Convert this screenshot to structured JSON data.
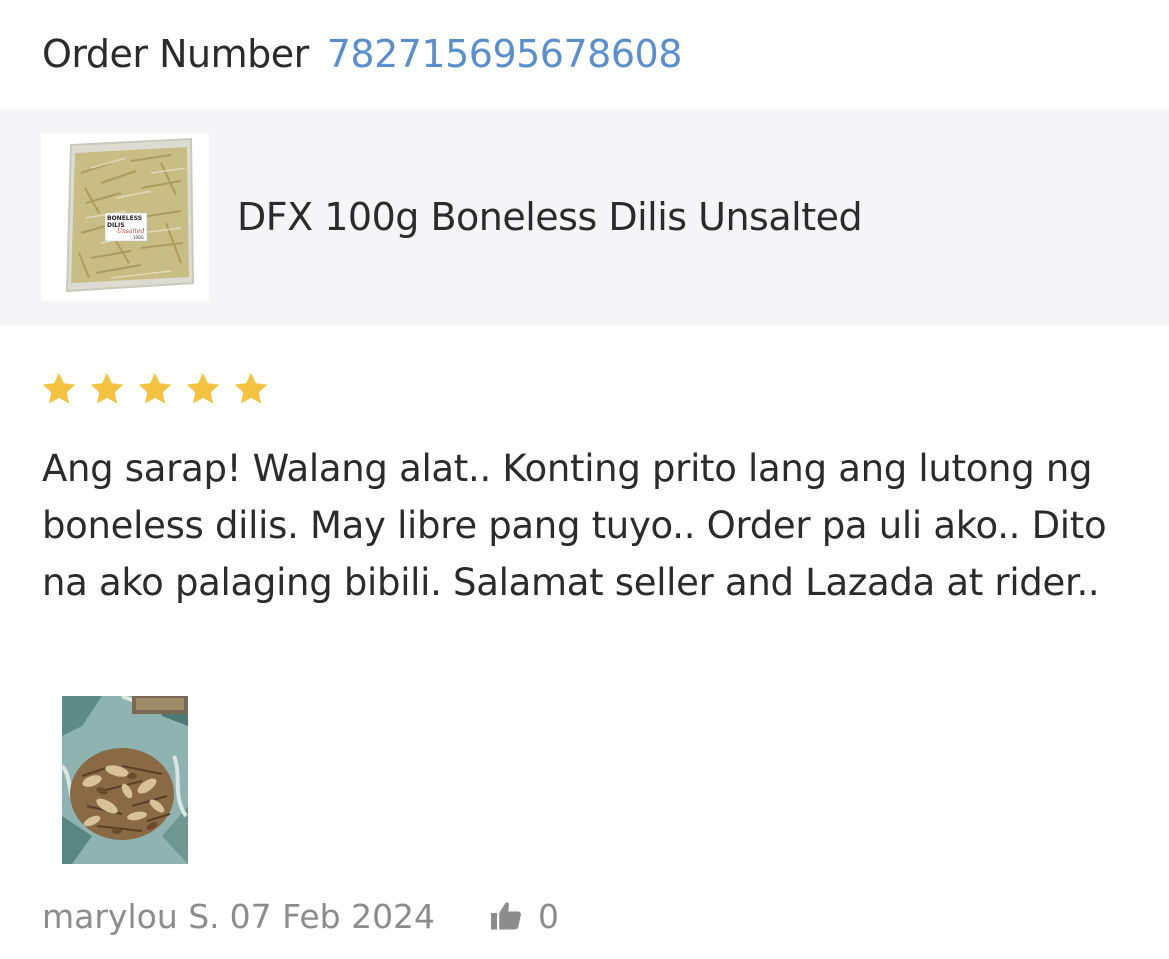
{
  "order": {
    "label": "Order Number",
    "number": "782715695678608"
  },
  "product": {
    "name": "DFX 100g Boneless Dilis Unsalted",
    "thumbnail_icon": "product-package-image",
    "package_label_line1": "BONELESS",
    "package_label_line2": "DILIS",
    "package_label_line3": "Unsalted",
    "package_label_line4": "100G"
  },
  "review": {
    "rating": 5,
    "rating_max": 5,
    "star_color": "#f5c242",
    "text": "Ang sarap! Walang alat.. Konting prito lang ang lutong ng boneless dilis. May libre pang tuyo.. Order pa uli ako.. Dito na ako palaging bibili. Salamat seller and Lazada at rider..",
    "photo_icon": "review-photo-fried-dilis",
    "reviewer": "marylou S.",
    "date": "07 Feb 2024",
    "like_icon": "thumbs-up-icon",
    "like_count": "0"
  },
  "colors": {
    "accent_link": "#5b8fcb",
    "panel_bg": "#f5f5f7",
    "muted_text": "#8c8c8c"
  }
}
